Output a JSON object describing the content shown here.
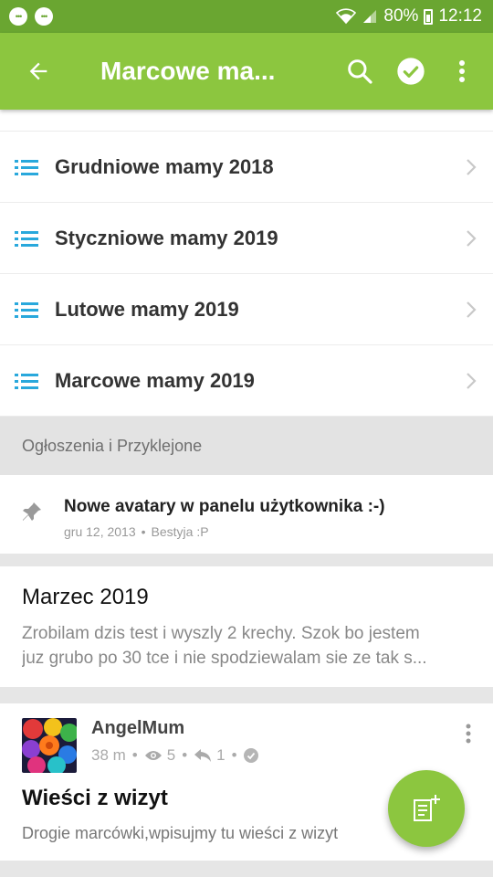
{
  "status_bar": {
    "battery": "80%",
    "time": "12:12"
  },
  "app_bar": {
    "title": "Marcowe ma..."
  },
  "forums": [
    {
      "label": "Grudniowe mamy 2018"
    },
    {
      "label": "Styczniowe mamy 2019"
    },
    {
      "label": "Lutowe mamy 2019"
    },
    {
      "label": "Marcowe mamy 2019"
    }
  ],
  "section": {
    "header": "Ogłoszenia i Przyklejone"
  },
  "pinned": {
    "title": "Nowe avatary w panelu użytkownika :-)",
    "date": "gru 12, 2013",
    "author": "Bestyja :P"
  },
  "post": {
    "title": "Marzec 2019",
    "excerpt_line1": "Zrobilam dzis test i wyszly 2 krechy. Szok bo jestem",
    "excerpt_line2": "juz grubo po 30 tce i nie spodziewalam sie ze tak s..."
  },
  "topic": {
    "author": "AngelMum",
    "time": "38 m",
    "views": "5",
    "replies": "1",
    "title": "Wieści z wizyt",
    "excerpt": "Drogie marcówki,wpisujmy tu wieści z wizyt"
  },
  "colors": {
    "accent": "#8cc63f",
    "status_bar": "#6aa631",
    "list_icon": "#29a8dc"
  },
  "icons": {
    "back": "arrow-left-icon",
    "search": "search-icon",
    "check": "check-circle-icon",
    "menu": "more-vert-icon",
    "fab": "new-topic-icon"
  }
}
